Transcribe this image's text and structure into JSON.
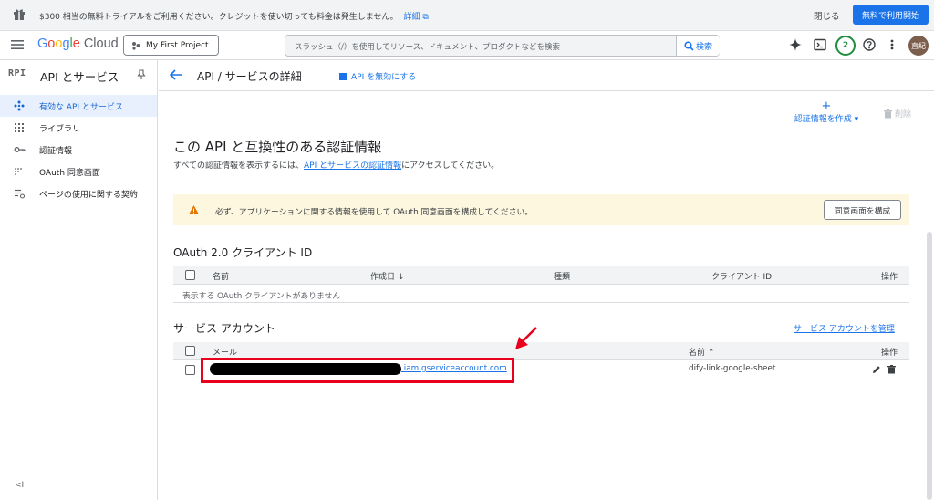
{
  "promo": {
    "message": "$300 相当の無料トライアルをご利用ください。クレジットを使い切っても料金は発生しません。",
    "details_link": "詳細",
    "close_label": "閉じる",
    "cta_label": "無料で利用開始"
  },
  "topbar": {
    "logo_g": "G",
    "logo_o1": "o",
    "logo_o2": "o",
    "logo_g2": "g",
    "logo_l": "l",
    "logo_e": "e",
    "logo_cloud": "Cloud",
    "project": "My First Project",
    "search_placeholder": "スラッシュ（/）を使用してリソース、ドキュメント、プロダクトなどを検索",
    "search_button": "検索",
    "notification_count": "2",
    "avatar_initials": "直紀"
  },
  "sidebar": {
    "glyph": "RPI",
    "title": "API とサービス",
    "items": [
      {
        "label": "有効な API とサービス"
      },
      {
        "label": "ライブラリ"
      },
      {
        "label": "認証情報"
      },
      {
        "label": "OAuth 同意画面"
      },
      {
        "label": "ページの使用に関する契約"
      }
    ],
    "collapse": "<I"
  },
  "main": {
    "title": "API / サービスの詳細",
    "disable_label": "API を無効にする",
    "create_label": "認証情報を作成",
    "delete_label": "削除",
    "section_title": "この API と互換性のある認証情報",
    "desc_before": "すべての認証情報を表示するには、",
    "desc_link": "API とサービスの認証情報",
    "desc_after": "にアクセスしてください。",
    "warning_text": "必ず、アプリケーションに関する情報を使用して OAuth 同意画面を構成してください。",
    "warning_button": "同意画面を構成"
  },
  "oauth": {
    "title": "OAuth 2.0 クライアント ID",
    "columns": [
      "名前",
      "作成日",
      "種類",
      "クライアント ID",
      "操作"
    ],
    "empty": "表示する OAuth クライアントがありません"
  },
  "service_accounts": {
    "title": "サービス アカウント",
    "manage_link": "サービス アカウントを管理",
    "columns": [
      "メール",
      "名前",
      "操作"
    ],
    "rows": [
      {
        "email_suffix": ".iam.gserviceaccount.com",
        "name": "dify-link-google-sheet"
      }
    ]
  },
  "colors": {
    "accent": "#1a73e8",
    "highlight": "#e8001c",
    "warning_bg": "#fef7e0"
  }
}
